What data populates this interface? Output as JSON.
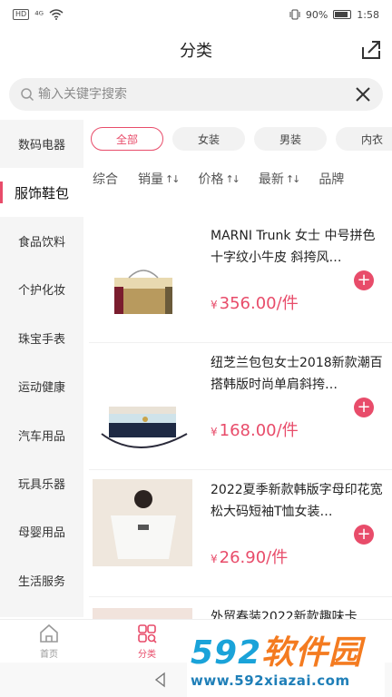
{
  "status": {
    "network": "⁴ᴳ",
    "battery_text": "90%",
    "battery_level": 0.9,
    "time": "1:58"
  },
  "header": {
    "title": "分类"
  },
  "search": {
    "placeholder": "输入关键字搜索"
  },
  "sidebar": {
    "items": [
      {
        "label": "数码电器"
      },
      {
        "label": "服饰鞋包"
      },
      {
        "label": "食品饮料"
      },
      {
        "label": "个护化妆"
      },
      {
        "label": "珠宝手表"
      },
      {
        "label": "运动健康"
      },
      {
        "label": "汽车用品"
      },
      {
        "label": "玩具乐器"
      },
      {
        "label": "母婴用品"
      },
      {
        "label": "生活服务"
      }
    ],
    "active_index": 1
  },
  "filters": {
    "chips": [
      "全部",
      "女装",
      "男装",
      "内衣"
    ],
    "active_index": 0
  },
  "sort": {
    "items": [
      "综合",
      "销量",
      "价格",
      "最新",
      "品牌"
    ],
    "arrow": "↑↓"
  },
  "products": [
    {
      "title": "MARNI Trunk 女士 中号拼色十字纹小牛皮 斜挎风…",
      "yen": "¥",
      "price": "356.00/件"
    },
    {
      "title": "纽芝兰包包女士2018新款潮百搭韩版时尚单肩斜挎…",
      "yen": "¥",
      "price": "168.00/件"
    },
    {
      "title": "2022夏季新款韩版字母印花宽松大码短袖T恤女装…",
      "yen": "¥",
      "price": "26.90/件"
    },
    {
      "title": "外贸春装2022新款趣味卡",
      "yen": "",
      "price": ""
    }
  ],
  "tabbar": {
    "items": [
      {
        "label": "首页"
      },
      {
        "label": "分类"
      }
    ],
    "active_index": 1
  },
  "watermark": {
    "main_num": "592",
    "main_text": "软件园",
    "url": "www.592xiazai.com"
  },
  "colors": {
    "accent": "#e84c6a"
  }
}
